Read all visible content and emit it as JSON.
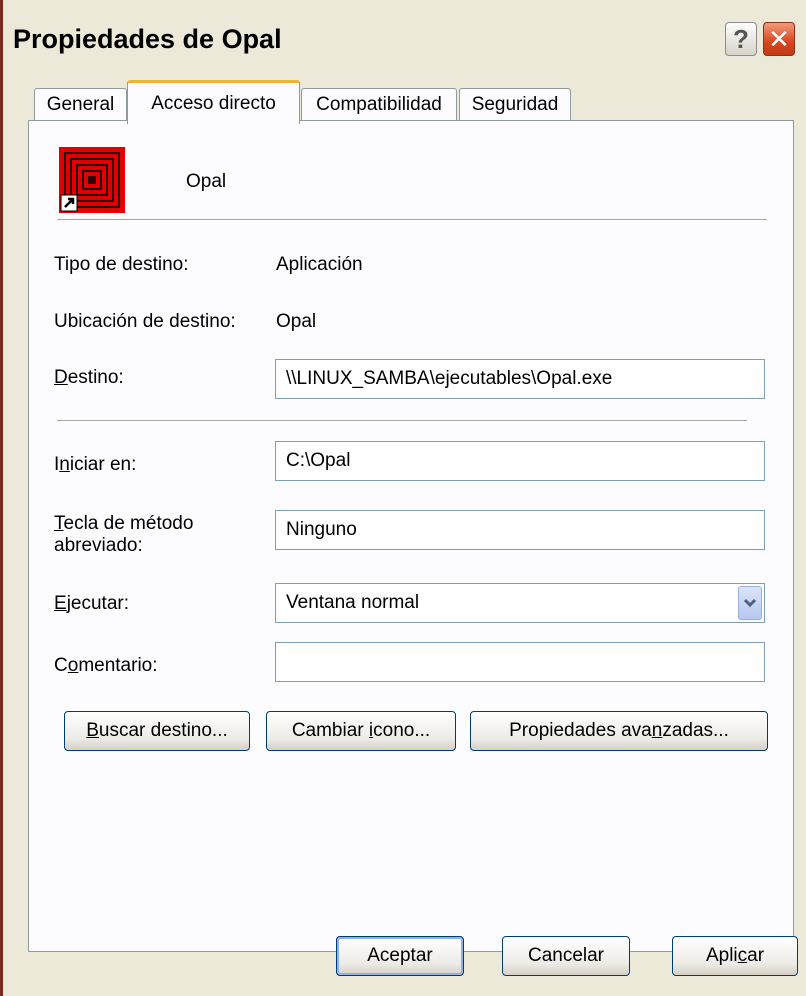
{
  "window": {
    "title": "Propiedades de Opal",
    "help_glyph": "?",
    "close_glyph": "✕"
  },
  "tabs": [
    {
      "label": "General"
    },
    {
      "label": "Acceso directo",
      "active": true
    },
    {
      "label": "Compatibilidad"
    },
    {
      "label": "Seguridad"
    }
  ],
  "shortcut": {
    "name": "Opal",
    "icon": "opal-concentric-squares-icon"
  },
  "fields": {
    "tipo_label": "Tipo de destino:",
    "tipo_value": "Aplicación",
    "ubicacion_label": "Ubicación de destino:",
    "ubicacion_value": "Opal",
    "destino_label_mnemonic": "D",
    "destino_label_rest": "estino:",
    "destino_value": "\\\\LINUX_SAMBA\\ejecutables\\Opal.exe",
    "iniciar_label_pre": "I",
    "iniciar_label_mnemonic": "n",
    "iniciar_label_rest": "iciar en:",
    "iniciar_value": "C:\\Opal",
    "tecla_label_mnemonic": "T",
    "tecla_label_rest": "ecla de método",
    "tecla_label_line2": "abreviado:",
    "tecla_value": "Ninguno",
    "ejecutar_label_mnemonic": "E",
    "ejecutar_label_rest": "jecutar:",
    "ejecutar_value": "Ventana normal",
    "comentario_label_pre": "C",
    "comentario_label_mnemonic": "o",
    "comentario_label_rest": "mentario:",
    "comentario_value": ""
  },
  "buttons": {
    "buscar_mnemonic": "B",
    "buscar_rest": "uscar destino...",
    "cambiar_pre": "Cambiar ",
    "cambiar_mnemonic": "i",
    "cambiar_rest": "cono...",
    "avanzadas_pre": "Propiedades ava",
    "avanzadas_mnemonic": "n",
    "avanzadas_rest": "zadas...",
    "aceptar": "Aceptar",
    "cancelar": "Cancelar",
    "aplicar_pre": "Apli",
    "aplicar_mnemonic": "c",
    "aplicar_rest": "ar"
  },
  "colors": {
    "face": "#ECE9D8",
    "tab_highlight": "#F2B233",
    "close_red": "#D8451F",
    "icon_red": "#E00000"
  }
}
